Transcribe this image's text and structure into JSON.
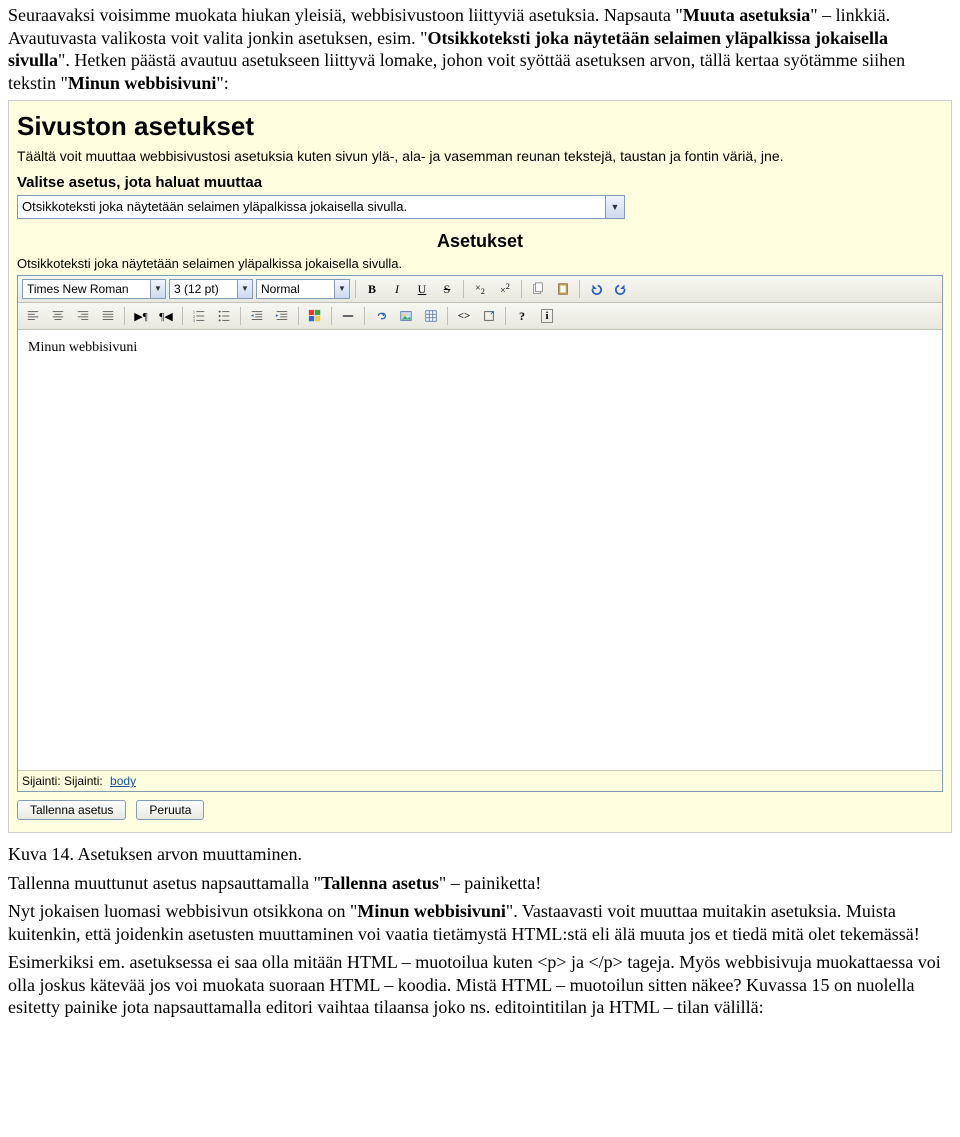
{
  "intro": {
    "p1a": "Seuraavaksi voisimme muokata hiukan yleisiä, webbisivustoon liittyviä asetuksia. Napsauta \"",
    "p1_link": "Muuta asetuksia",
    "p1b": "\" – linkkiä. Avautuvasta valikosta voit valita jonkin asetuksen, esim. \"",
    "p1_opt": "Otsikkoteksti joka näytetään selaimen yläpalkissa jokaisella sivulla",
    "p1c": "\". Hetken päästä avautuu asetukseen liittyvä lomake, johon voit syöttää asetuksen arvon, tällä kertaa syötämme siihen tekstin \"",
    "p1_val": "Minun webbisivuni",
    "p1d": "\":"
  },
  "screenshot": {
    "title": "Sivuston asetukset",
    "subtitle": "Täältä voit muuttaa webbisivustosi asetuksia kuten sivun ylä-, ala- ja vasemman reunan tekstejä, taustan ja fontin väriä, jne.",
    "choose_label": "Valitse asetus, jota haluat muuttaa",
    "select_value": "Otsikkoteksti joka näytetään selaimen yläpalkissa jokaisella sivulla.",
    "section_title": "Asetukset",
    "field_label": "Otsikkoteksti joka näytetään selaimen yläpalkissa jokaisella sivulla.",
    "toolbar": {
      "font": "Times New Roman",
      "size": "3 (12 pt)",
      "style": "Normal"
    },
    "editor_text": "Minun webbisivuni",
    "path_prefix": "Sijainti: Sijainti:",
    "path_link": "body",
    "save_btn": "Tallenna asetus",
    "cancel_btn": "Peruuta"
  },
  "caption": "Kuva 14. Asetuksen arvon muuttaminen.",
  "outro": {
    "p2a": "Tallenna muuttunut asetus napsauttamalla \"",
    "p2_btn": "Tallenna asetus",
    "p2b": "\" – painiketta!",
    "p3a": "Nyt jokaisen luomasi webbisivun otsikkona on \"",
    "p3_val": "Minun webbisivuni",
    "p3b": "\". Vastaavasti voit muuttaa muitakin asetuksia. Muista kuitenkin, että joidenkin asetusten muuttaminen voi vaatia tietämystä HTML:stä eli älä muuta jos et tiedä mitä olet tekemässä!",
    "p4": "Esimerkiksi em. asetuksessa ei saa olla mitään HTML – muotoilua kuten <p> ja </p> tageja. Myös webbisivuja muokattaessa voi olla joskus kätevää jos voi muokata suoraan HTML – koodia. Mistä HTML – muotoilun sitten näkee? Kuvassa 15 on nuolella esitetty painike jota napsauttamalla editori vaihtaa tilaansa joko ns. editointitilan ja HTML – tilan välillä:"
  }
}
